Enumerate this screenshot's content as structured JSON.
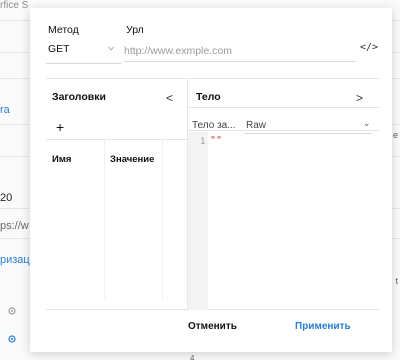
{
  "background": {
    "top_text": "rfice S",
    "left_fragments": [
      "ra",
      "20",
      "ps://w",
      "ризаци"
    ],
    "right_fragments": [
      "e",
      "t"
    ],
    "footer_number": "4"
  },
  "dialog": {
    "method": {
      "label": "Метод",
      "value": "GET"
    },
    "url": {
      "label": "Урл",
      "placeholder": "http://www.exmple.com",
      "value": ""
    },
    "code_icon": "</>",
    "headers": {
      "title": "Заголовки",
      "collapse_chevron": "<",
      "add_symbol": "+",
      "columns": [
        "Имя",
        "Значение"
      ]
    },
    "body": {
      "title": "Тело",
      "expand_chevron": ">",
      "type_label": "Тело за...",
      "format": "Raw",
      "line_number": "1",
      "content": "\"\""
    },
    "actions": {
      "cancel": "Отменить",
      "apply": "Применить"
    }
  }
}
